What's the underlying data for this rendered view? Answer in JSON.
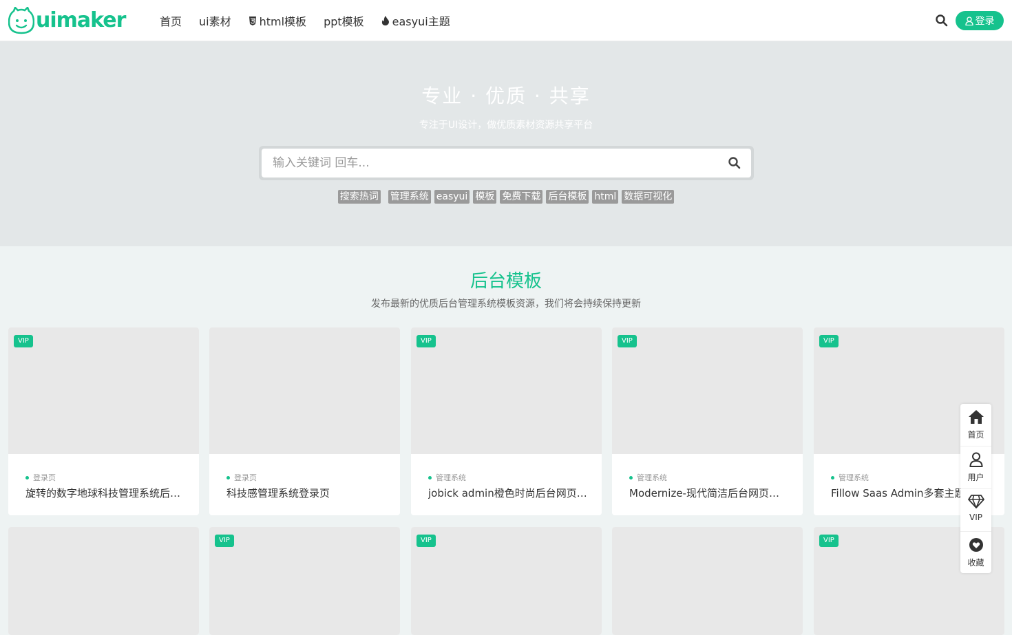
{
  "brand": {
    "name": "uimaker",
    "color": "#16c28d"
  },
  "nav": [
    {
      "label": "首页",
      "icon": ""
    },
    {
      "label": "ui素材",
      "icon": ""
    },
    {
      "label": "html模板",
      "icon": "html5-icon"
    },
    {
      "label": "ppt模板",
      "icon": ""
    },
    {
      "label": "easyui主题",
      "icon": "fire-icon"
    }
  ],
  "header": {
    "login_label": "登录"
  },
  "hero": {
    "title": "专业 · 优质 · 共享",
    "subtitle": "专注于UI设计，做优质素材资源共享平台",
    "search_placeholder": "输入关键词 回车...",
    "hot_label": "搜索热词",
    "tags": [
      "管理系统",
      "easyui",
      "模板",
      "免费下载",
      "后台模板",
      "html",
      "数据可视化"
    ]
  },
  "section": {
    "title": "后台模板",
    "subtitle": "发布最新的优质后台管理系统模板资源，我们将会持续保持更新"
  },
  "cards": [
    {
      "vip": "VIP",
      "category": "登录页",
      "title": "旋转的数字地球科技管理系统后台登录页"
    },
    {
      "vip": "",
      "category": "登录页",
      "title": "科技感管理系统登录页"
    },
    {
      "vip": "VIP",
      "category": "管理系统",
      "title": "jobick admin橙色时尚后台网页模板"
    },
    {
      "vip": "VIP",
      "category": "管理系统",
      "title": "Modernize-现代简洁后台网页模板"
    },
    {
      "vip": "VIP",
      "category": "管理系统",
      "title": "Fillow Saas Admin多套主题"
    },
    {
      "vip": "",
      "category": "",
      "title": ""
    },
    {
      "vip": "VIP",
      "category": "",
      "title": ""
    },
    {
      "vip": "VIP",
      "category": "",
      "title": ""
    },
    {
      "vip": "",
      "category": "",
      "title": ""
    },
    {
      "vip": "VIP",
      "category": "",
      "title": ""
    }
  ],
  "float_bar": [
    {
      "label": "首页",
      "icon": "home-icon"
    },
    {
      "label": "用户",
      "icon": "user-icon"
    },
    {
      "label": "VIP",
      "icon": "diamond-icon"
    },
    {
      "label": "收藏",
      "icon": "heart-icon"
    }
  ]
}
